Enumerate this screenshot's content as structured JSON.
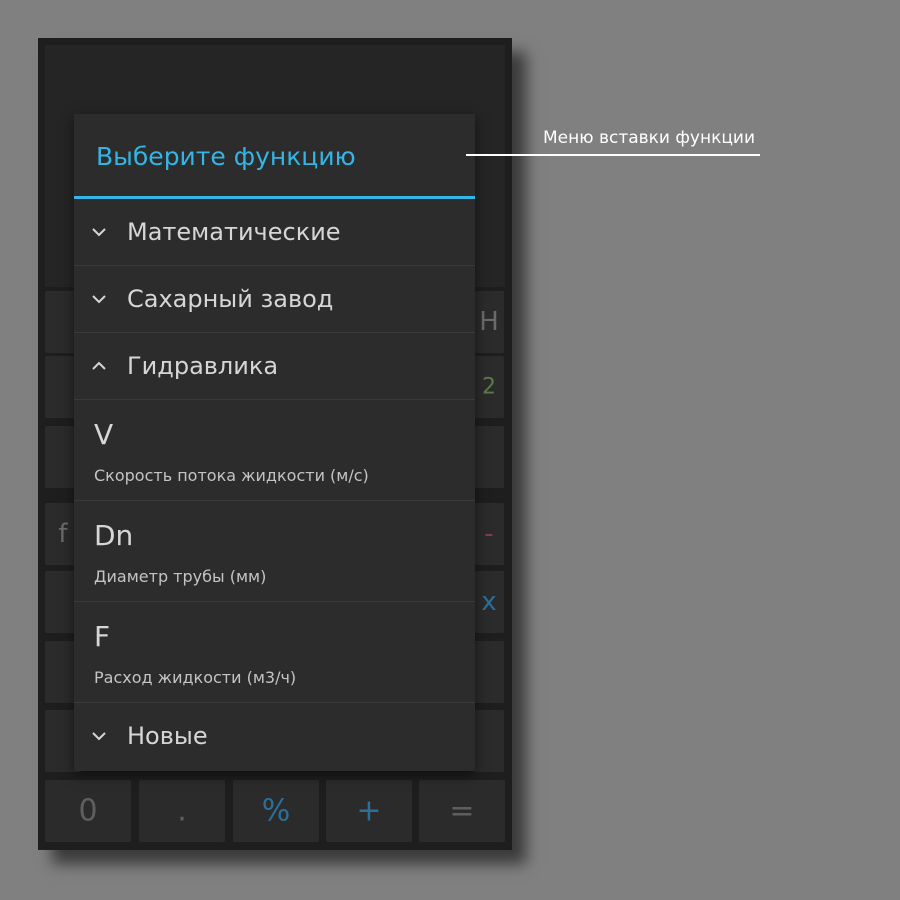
{
  "dialog": {
    "title": "Выберите функцию",
    "groups": [
      {
        "label": "Математические",
        "expanded": false
      },
      {
        "label": "Сахарный завод",
        "expanded": false
      },
      {
        "label": "Гидравлика",
        "expanded": true,
        "items": [
          {
            "symbol": "V",
            "description": "Скорость потока жидкости (м/с)"
          },
          {
            "symbol": "Dn",
            "description": "Диаметр трубы (мм)"
          },
          {
            "symbol": "F",
            "description": "Расход жидкости (м3/ч)"
          }
        ]
      },
      {
        "label": "Новые",
        "expanded": false
      }
    ]
  },
  "callout": {
    "text": "Меню вставки функции"
  },
  "keypad": {
    "bottom_row": [
      "0",
      ".",
      "%",
      "+",
      "="
    ],
    "partial_glyphs": {
      "row1_right": "H",
      "row2_right": "2",
      "row4_left": "f",
      "row4_right": "-",
      "row5_right": "x"
    }
  },
  "colors": {
    "accent": "#33b5e5",
    "dialog_bg": "#2c2c2c",
    "app_bg": "#1e1e1e",
    "key_bg": "#2b2b2b"
  }
}
